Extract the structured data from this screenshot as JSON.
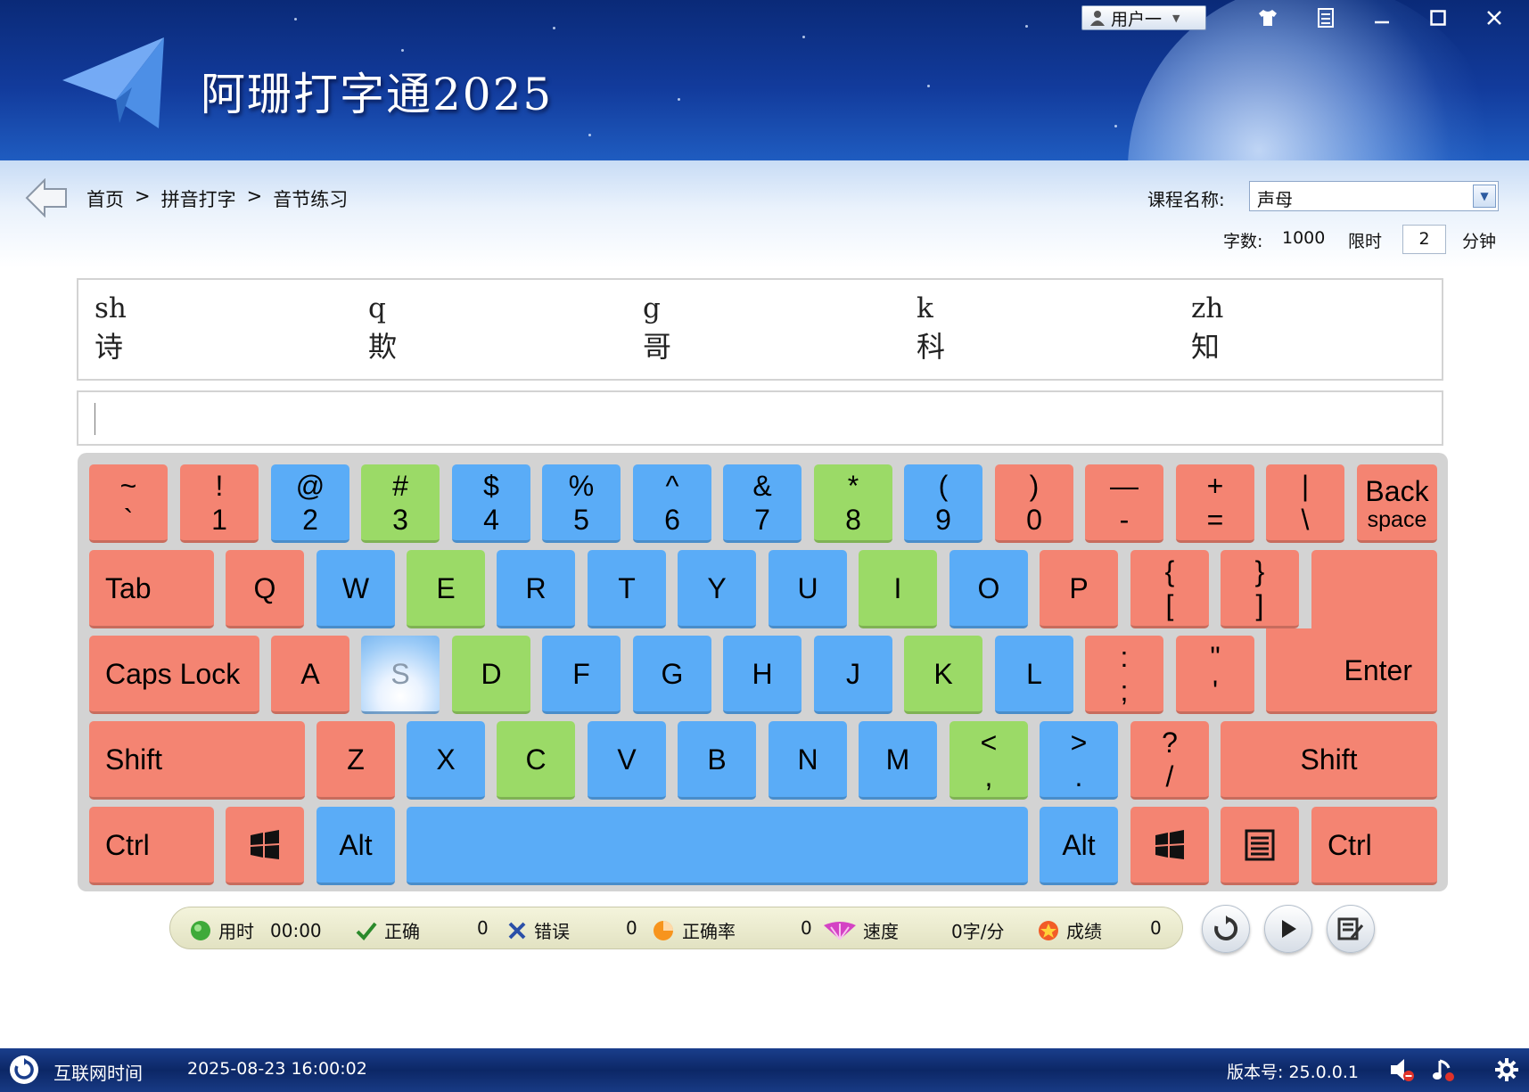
{
  "app": {
    "title": "阿珊打字通2025",
    "user_label": "用户一"
  },
  "breadcrumb": {
    "items": [
      "首页",
      ">",
      "拼音打字",
      ">",
      "音节练习"
    ]
  },
  "course": {
    "label": "课程名称:",
    "value": "声母",
    "char_count_label": "字数:",
    "char_count": "1000",
    "time_limit_label": "限时",
    "time_limit": "2",
    "time_unit": "分钟"
  },
  "practice": {
    "syllables": [
      {
        "pinyin": "sh",
        "hanzi": "诗"
      },
      {
        "pinyin": "q",
        "hanzi": "欺"
      },
      {
        "pinyin": "g",
        "hanzi": "哥"
      },
      {
        "pinyin": "k",
        "hanzi": "科"
      },
      {
        "pinyin": "zh",
        "hanzi": "知"
      }
    ],
    "input_value": ""
  },
  "keyboard": {
    "row1": [
      {
        "top": "~",
        "bottom": "`"
      },
      {
        "top": "!",
        "bottom": "1"
      },
      {
        "top": "@",
        "bottom": "2"
      },
      {
        "top": "#",
        "bottom": "3"
      },
      {
        "top": "$",
        "bottom": "4"
      },
      {
        "top": "%",
        "bottom": "5"
      },
      {
        "top": "^",
        "bottom": "6"
      },
      {
        "top": "&",
        "bottom": "7"
      },
      {
        "top": "*",
        "bottom": "8"
      },
      {
        "top": "(",
        "bottom": "9"
      },
      {
        "top": ")",
        "bottom": "0"
      },
      {
        "top": "—",
        "bottom": "-"
      },
      {
        "top": "+",
        "bottom": "="
      },
      {
        "top": "|",
        "bottom": "\\"
      },
      {
        "top": "Back",
        "bottom": "space"
      }
    ],
    "row2": [
      "Tab",
      "Q",
      "W",
      "E",
      "R",
      "T",
      "Y",
      "U",
      "I",
      "O",
      "P",
      "{",
      "[",
      "}",
      "]"
    ],
    "row3": [
      "Caps Lock",
      "A",
      "S",
      "D",
      "F",
      "G",
      "H",
      "J",
      "K",
      "L",
      ":",
      ";",
      "\"",
      "'",
      "Enter"
    ],
    "row4": [
      "Shift",
      "Z",
      "X",
      "C",
      "V",
      "B",
      "N",
      "M",
      "<",
      ",",
      ">",
      ".",
      "?",
      "/",
      "Shift"
    ],
    "row5": [
      "Ctrl",
      "Alt",
      "Alt",
      "Ctrl"
    ],
    "highlighted_key": "S",
    "colors": {
      "red": "#f48472",
      "blue": "#5aacf7",
      "green": "#9bda67"
    }
  },
  "stats": {
    "time_label": "用时",
    "time_value": "00:00",
    "correct_label": "正确",
    "correct_value": "0",
    "error_label": "错误",
    "error_value": "0",
    "accuracy_label": "正确率",
    "accuracy_value": "0",
    "speed_label": "速度",
    "speed_value": "0字/分",
    "score_label": "成绩",
    "score_value": "0"
  },
  "footer": {
    "net_time_label": "互联网时间",
    "datetime": "2025-08-23 16:00:02",
    "version": "版本号: 25.0.0.1"
  }
}
